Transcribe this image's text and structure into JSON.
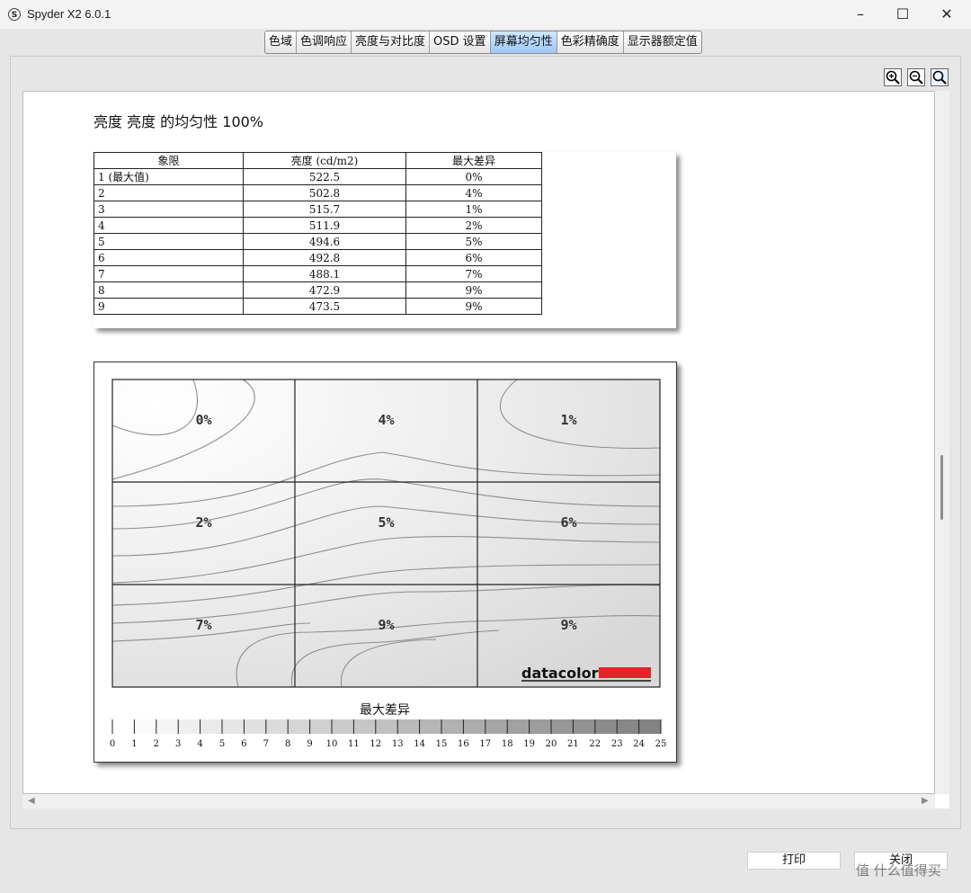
{
  "window": {
    "title": "Spyder X2 6.0.1",
    "icon_letter": "S",
    "minimize": "–",
    "maximize": "☐",
    "close": "✕"
  },
  "tabs": [
    {
      "label": "色域",
      "active": false
    },
    {
      "label": "色调响应",
      "active": false
    },
    {
      "label": "亮度与对比度",
      "active": false
    },
    {
      "label": "OSD 设置",
      "active": false
    },
    {
      "label": "屏幕均匀性",
      "active": true
    },
    {
      "label": "色彩精确度",
      "active": false
    },
    {
      "label": "显示器额定值",
      "active": false
    }
  ],
  "zoom_tools": [
    "zoom-in-icon",
    "zoom-out-icon",
    "zoom-fit-icon"
  ],
  "report": {
    "title": "亮度 亮度 的均匀性 100%",
    "table": {
      "headers": [
        "象限",
        "亮度 (cd/m2)",
        "最大差异"
      ],
      "rows": [
        [
          "1 (最大值)",
          "522.5",
          "0%"
        ],
        [
          "2",
          "502.8",
          "4%"
        ],
        [
          "3",
          "515.7",
          "1%"
        ],
        [
          "4",
          "511.9",
          "2%"
        ],
        [
          "5",
          "494.6",
          "5%"
        ],
        [
          "6",
          "492.8",
          "6%"
        ],
        [
          "7",
          "488.1",
          "7%"
        ],
        [
          "8",
          "472.9",
          "9%"
        ],
        [
          "9",
          "473.5",
          "9%"
        ]
      ]
    }
  },
  "chart_data": {
    "type": "heatmap",
    "grid": {
      "rows": 3,
      "cols": 3
    },
    "cells": [
      [
        "0%",
        "4%",
        "1%"
      ],
      [
        "2%",
        "5%",
        "6%"
      ],
      [
        "7%",
        "9%",
        "9%"
      ]
    ],
    "values": [
      [
        0,
        4,
        1
      ],
      [
        2,
        5,
        6
      ],
      [
        7,
        9,
        9
      ]
    ],
    "logo": "datacolor",
    "legend": {
      "title": "最大差异",
      "min": 0,
      "max": 25,
      "ticks": [
        "0",
        "1",
        "2",
        "3",
        "4",
        "5",
        "6",
        "7",
        "8",
        "9",
        "10",
        "11",
        "12",
        "13",
        "14",
        "15",
        "16",
        "17",
        "18",
        "19",
        "20",
        "21",
        "22",
        "23",
        "24",
        "25"
      ]
    }
  },
  "buttons": {
    "print": "打印",
    "close": "关闭"
  },
  "watermark": "值 什么值得买",
  "scroll_arrows": {
    "left": "◀",
    "right": "▶"
  }
}
